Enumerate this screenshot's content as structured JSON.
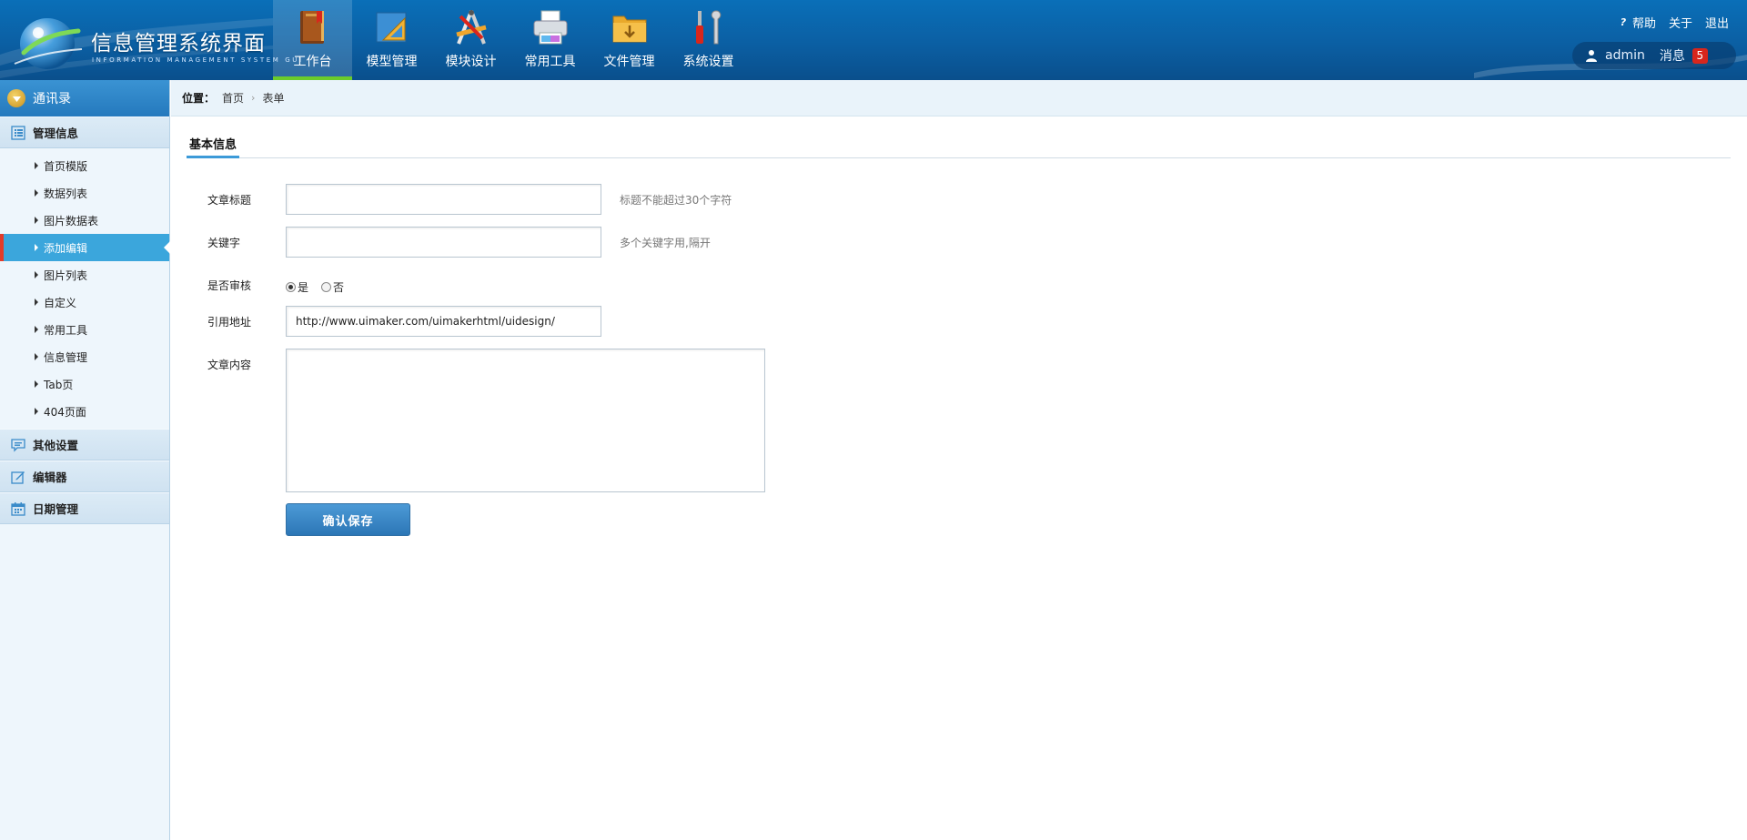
{
  "header": {
    "logo_title": "信息管理系统界面",
    "logo_subtitle": "INFORMATION MANAGEMENT SYSTEM GUI",
    "nav": [
      {
        "label": "工作台",
        "icon": "book-icon"
      },
      {
        "label": "模型管理",
        "icon": "ruler-icon"
      },
      {
        "label": "模块设计",
        "icon": "drawing-tools-icon"
      },
      {
        "label": "常用工具",
        "icon": "printer-icon"
      },
      {
        "label": "文件管理",
        "icon": "folder-icon"
      },
      {
        "label": "系统设置",
        "icon": "tools-icon"
      }
    ],
    "active_nav": 0,
    "links": {
      "help": "帮助",
      "about": "关于",
      "logout": "退出"
    },
    "user": {
      "name": "admin",
      "messages_label": "消息",
      "messages_count": "5"
    }
  },
  "sidebar": {
    "title": "通讯录",
    "groups": [
      {
        "label": "管理信息",
        "icon": "list-icon"
      },
      {
        "label": "其他设置",
        "icon": "chat-icon"
      },
      {
        "label": "编辑器",
        "icon": "edit-icon"
      },
      {
        "label": "日期管理",
        "icon": "calendar-icon"
      }
    ],
    "items": [
      "首页模版",
      "数据列表",
      "图片数据表",
      "添加编辑",
      "图片列表",
      "自定义",
      "常用工具",
      "信息管理",
      "Tab页",
      "404页面"
    ],
    "active_item": 3
  },
  "breadcrumb": {
    "label": "位置：",
    "home": "首页",
    "current": "表单"
  },
  "panel": {
    "tab": "基本信息"
  },
  "form": {
    "title_label": "文章标题",
    "title_value": "",
    "title_hint": "标题不能超过30个字符",
    "keyword_label": "关键字",
    "keyword_value": "",
    "keyword_hint": "多个关键字用,隔开",
    "review_label": "是否审核",
    "review_yes": "是",
    "review_no": "否",
    "review_selected": "是",
    "url_label": "引用地址",
    "url_value": "http://www.uimaker.com/uimakerhtml/uidesign/",
    "content_label": "文章内容",
    "content_value": "",
    "save_label": "确认保存"
  },
  "colors": {
    "header": "#0b62a8",
    "accent": "#3ba6dc",
    "active_bar": "#6bcb2b",
    "badge": "#d8261c"
  }
}
